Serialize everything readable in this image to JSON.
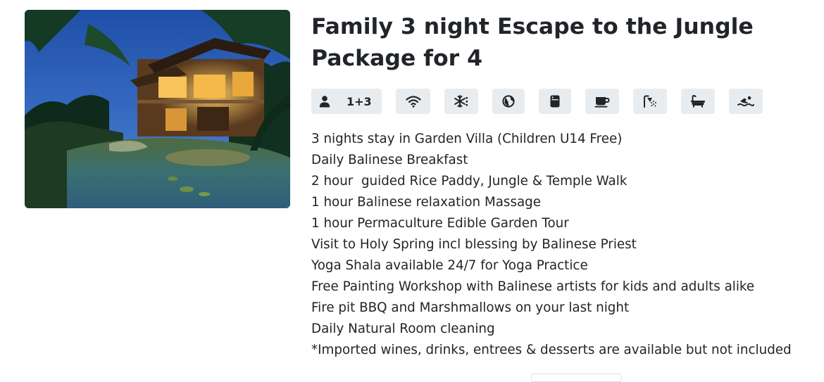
{
  "package": {
    "title": "Family 3 night Escape to the Jungle Package for 4",
    "photo_alt": "Family 3 night Escape to the Jungle Package for 4"
  },
  "amenities": {
    "guests": "1+3",
    "icons": [
      "guest-icon",
      "wifi-icon",
      "air-conditioning-icon",
      "globe-icon",
      "mini-fridge-icon",
      "coffee-icon",
      "shower-icon",
      "bathtub-icon",
      "swimming-pool-icon"
    ]
  },
  "features": [
    "3 nights stay in Garden Villa (Children U14 Free)",
    "Daily Balinese Breakfast",
    "2 hour  guided Rice Paddy, Jungle & Temple Walk",
    "1 hour Balinese relaxation Massage",
    "1 hour Permaculture Edible Garden Tour",
    "Visit to Holy Spring incl blessing by Balinese Priest",
    "Yoga Shala available 24/7 for Yoga Practice",
    "Free Painting Workshop with Balinese artists for kids and adults alike",
    "Fire pit BBQ and Marshmallows on your last night",
    "Daily Natural Room cleaning",
    "*Imported wines, drinks, entrees & desserts are available but not included"
  ],
  "colors": {
    "text": "#212529",
    "pill_bg": "#e9ecef"
  }
}
